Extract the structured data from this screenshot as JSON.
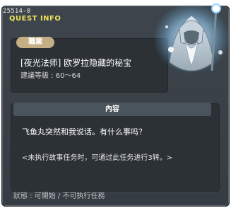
{
  "header": {
    "quest_id": "25514-0",
    "section": "QUEST INFO"
  },
  "quest": {
    "job_label": "職業",
    "title": "[夜光法师] 欧罗拉隐藏的秘宝",
    "level_range": "建議等級 : 60～64"
  },
  "content": {
    "header": "內容",
    "dialog": "飞鱼丸突然和我说话。有什么事吗？",
    "note": "<未执行故事任务时，可通过此任务进行3转。>"
  },
  "status": "狀態 : 可開始 / 不可执行任務",
  "npc": {
    "icon": "luminous-mage-npc-icon",
    "glow_color": "#9fd8ff"
  }
}
